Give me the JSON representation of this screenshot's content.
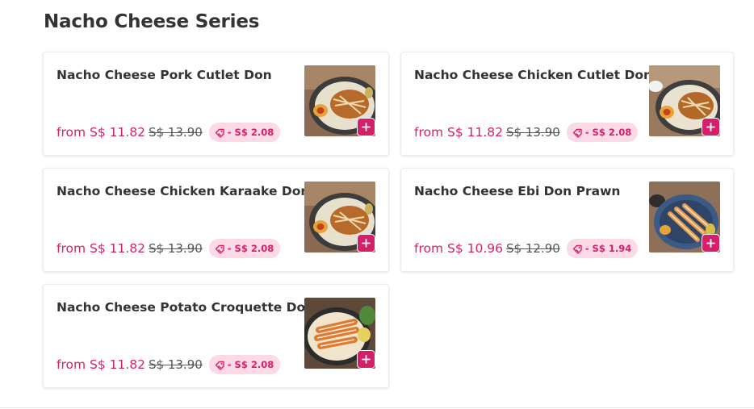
{
  "section": {
    "title": "Nacho Cheese Series"
  },
  "colors": {
    "accent": "#d61f69",
    "badge_bg": "#fcd9e6"
  },
  "icons": {
    "badge": "discount-tag-icon",
    "add": "plus-icon"
  },
  "items": [
    {
      "name": "Nacho Cheese Pork Cutlet Don",
      "price": "from S$ 11.82",
      "original_price": "S$ 13.90",
      "discount": "- S$ 2.08"
    },
    {
      "name": "Nacho Cheese Chicken Cutlet Don",
      "price": "from S$ 11.82",
      "original_price": "S$ 13.90",
      "discount": "- S$ 2.08"
    },
    {
      "name": "Nacho Cheese Chicken Karaake Don",
      "price": "from S$ 11.82",
      "original_price": "S$ 13.90",
      "discount": "- S$ 2.08"
    },
    {
      "name": "Nacho Cheese Ebi Don Prawn",
      "price": "from S$ 10.96",
      "original_price": "S$ 12.90",
      "discount": "- S$ 1.94"
    },
    {
      "name": "Nacho Cheese Potato Croquette Don",
      "price": "from S$ 11.82",
      "original_price": "S$ 13.90",
      "discount": "- S$ 2.08"
    }
  ]
}
